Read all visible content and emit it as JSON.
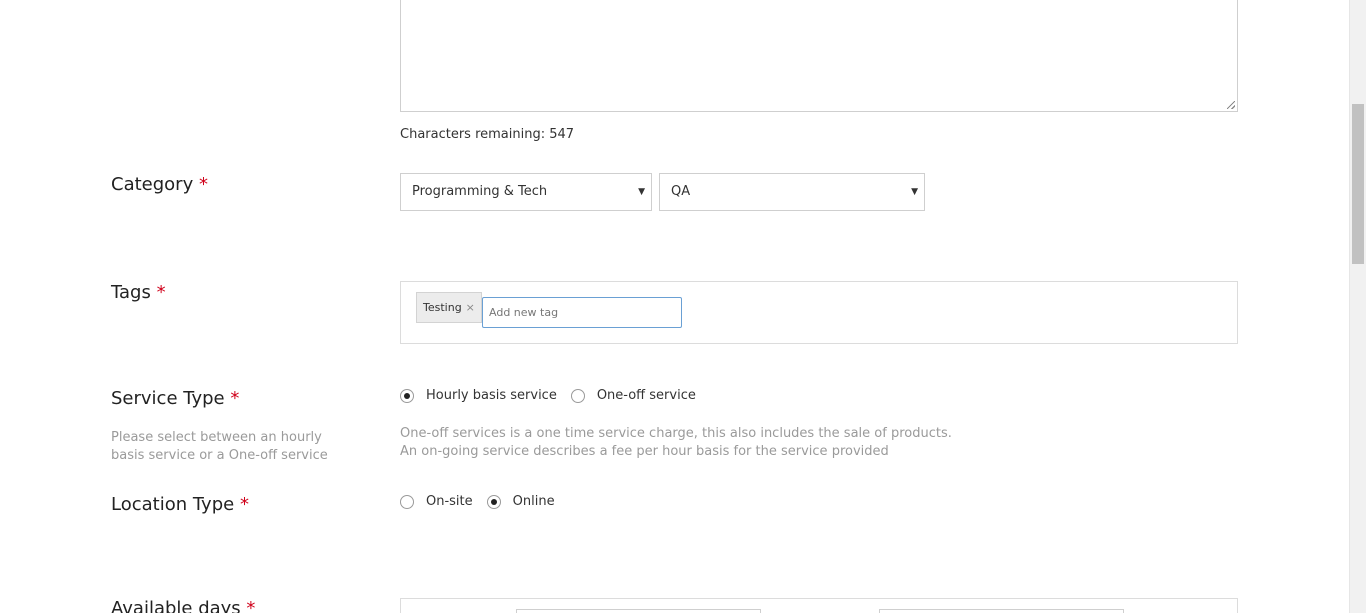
{
  "description": {
    "chars_remaining_label": "Characters remaining: 547"
  },
  "category": {
    "label": "Category",
    "required_mark": "*",
    "main_value": "Programming & Tech",
    "sub_value": "QA"
  },
  "tags": {
    "label": "Tags",
    "required_mark": "*",
    "items": [
      "Testing"
    ],
    "remove_glyph": "×",
    "input_placeholder": "Add new tag"
  },
  "service_type": {
    "label": "Service Type",
    "required_mark": "*",
    "sub_label": "Please select between an hourly basis service or a One-off service",
    "options": [
      {
        "label": "Hourly basis service",
        "checked": true
      },
      {
        "label": "One-off service",
        "checked": false
      }
    ],
    "help_line_1": "One-off services is a one time service charge, this also includes the sale of products.",
    "help_line_2": "An on-going service describes a fee per hour basis for the service provided"
  },
  "location_type": {
    "label": "Location Type",
    "required_mark": "*",
    "options": [
      {
        "label": "On-site",
        "checked": false
      },
      {
        "label": "Online",
        "checked": true
      }
    ]
  },
  "available_days": {
    "label": "Available days",
    "required_mark": "*"
  },
  "colors": {
    "required": "#d0021b",
    "focus_border": "#6aa0d4"
  }
}
